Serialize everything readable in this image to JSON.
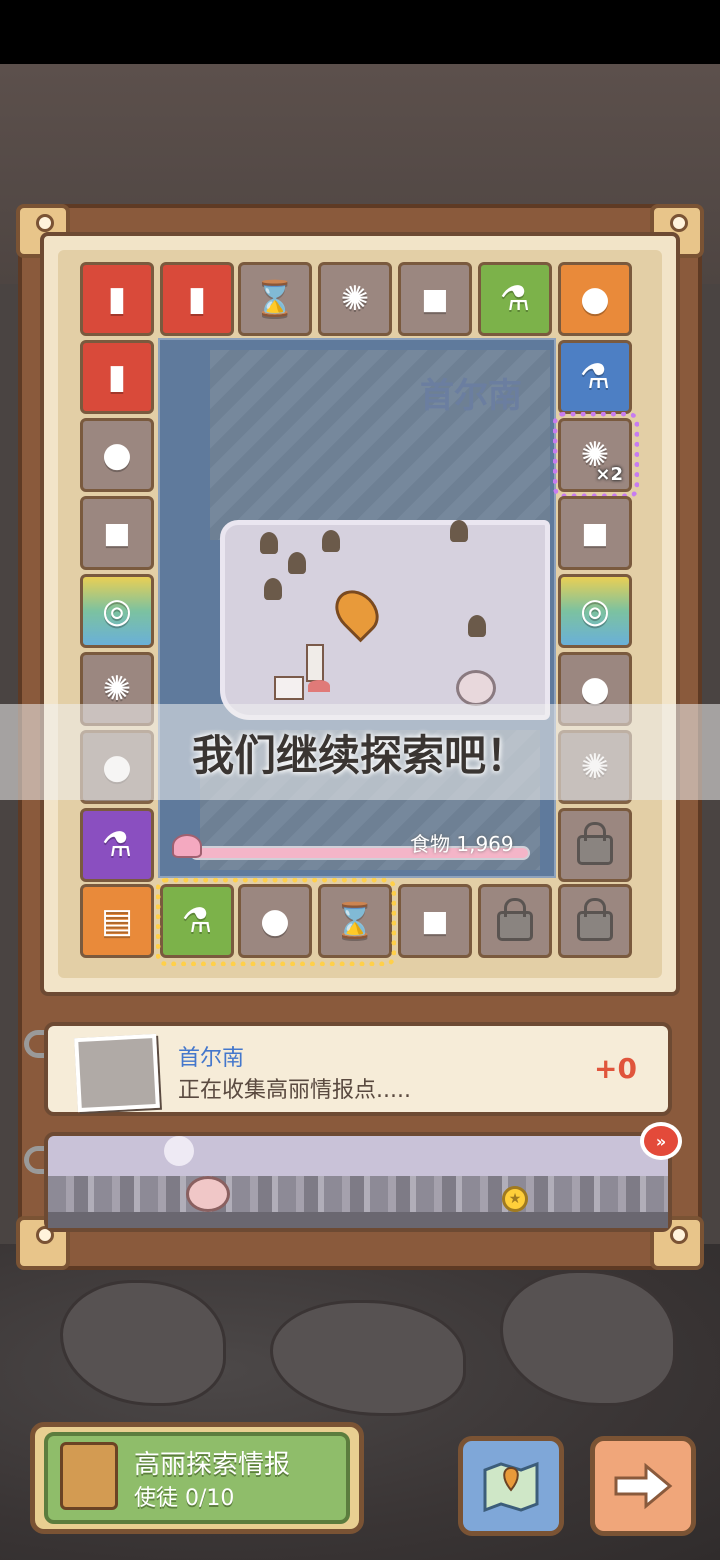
{
  "map": {
    "region_name": "首尔南",
    "food_label": "食物",
    "food_value": "1,969"
  },
  "banner": {
    "text": "我们继续探索吧！"
  },
  "tiles": {
    "top": [
      "battery-icon",
      "battery-icon",
      "hourglass-icon",
      "rune-icon",
      "meat-icon",
      "potion-icon",
      "ghost-icon"
    ],
    "left": [
      "battery-icon",
      "ghost-icon",
      "meat-icon",
      "shell-card-icon",
      "rune-icon",
      "ghost-icon",
      "potion-icon"
    ],
    "right": [
      "potion-icon",
      "rune-icon",
      "meat-icon",
      "shell-card-icon",
      "ghost-icon",
      "rune-icon",
      "lock-icon"
    ],
    "bottom": [
      "map-scroll-icon",
      "potion-icon",
      "ghost-icon",
      "hourglass-icon",
      "meat-icon",
      "lock-icon",
      "lock-icon"
    ],
    "multiplier": "×2"
  },
  "info": {
    "title": "首尔南",
    "subtitle": "正在收集高丽情报点.....",
    "plus_icon": "+0"
  },
  "progress": {
    "ff_label": "»",
    "star": "★"
  },
  "bottom": {
    "intel_title": "高丽探索情报",
    "intel_label": "使徒",
    "intel_count": "0/10"
  },
  "colors": {
    "frame": "#8a5a3c",
    "map_sea": "#5f7a9c",
    "map_land": "#d6d1de",
    "highlight": "#ffd04a",
    "accent_red": "#e34a3a"
  }
}
